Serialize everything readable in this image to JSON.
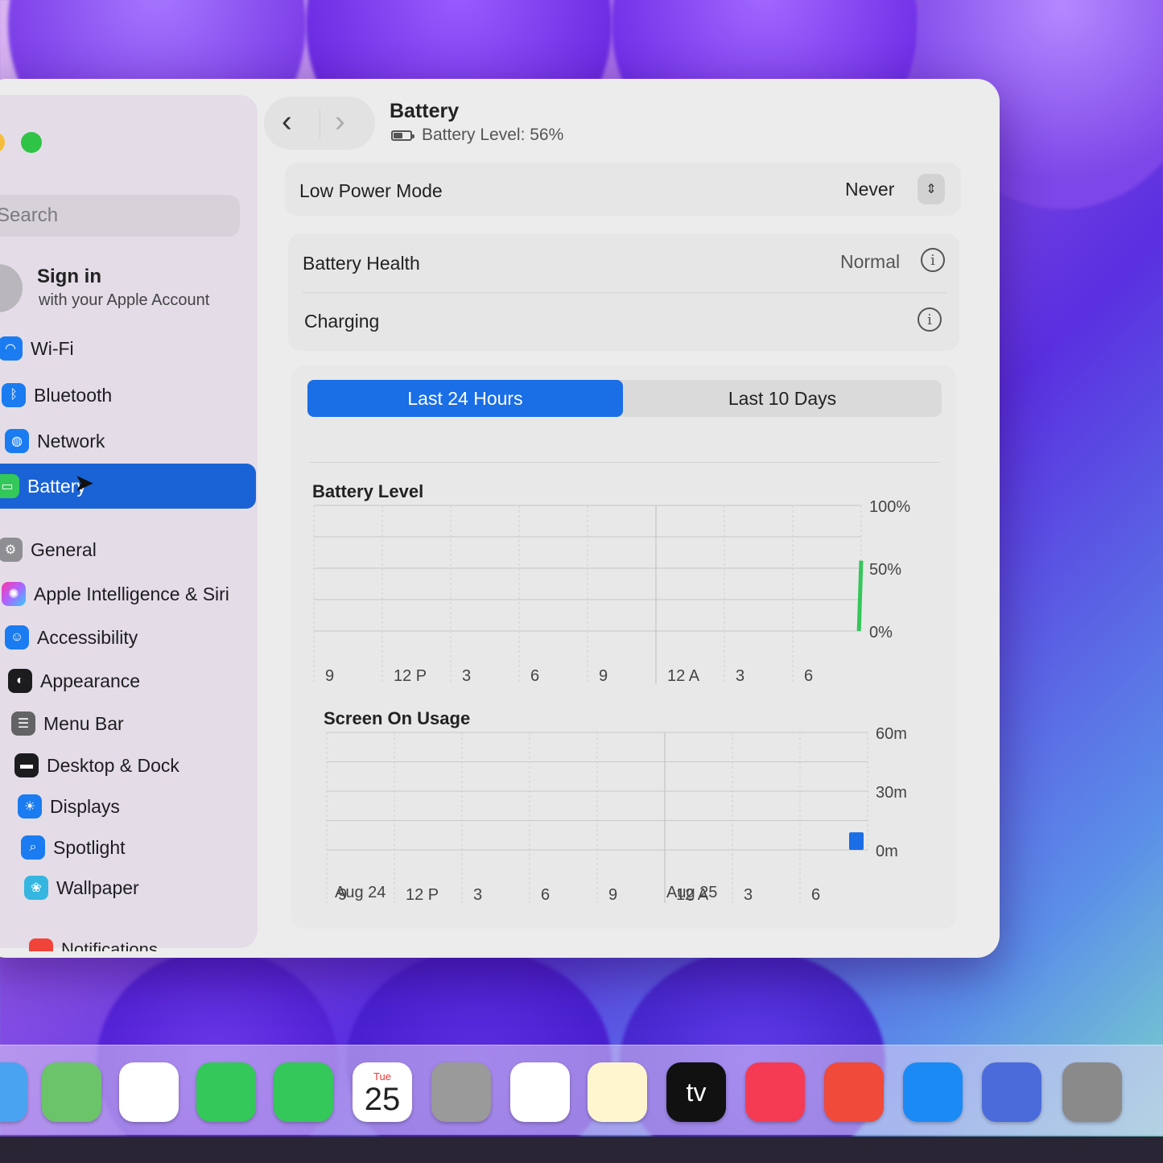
{
  "sidebar": {
    "search_placeholder": "Search",
    "account": {
      "title": "Sign in",
      "subtitle": "with your Apple Account"
    },
    "items": [
      {
        "label": "Wi-Fi",
        "icon": "wifi-icon"
      },
      {
        "label": "Bluetooth",
        "icon": "bluetooth-icon"
      },
      {
        "label": "Network",
        "icon": "globe-icon"
      },
      {
        "label": "Battery",
        "icon": "battery-icon",
        "selected": true
      },
      {
        "label": "General",
        "icon": "gear-icon"
      },
      {
        "label": "Apple Intelligence & Siri",
        "icon": "siri-icon"
      },
      {
        "label": "Accessibility",
        "icon": "accessibility-icon"
      },
      {
        "label": "Appearance",
        "icon": "appearance-icon"
      },
      {
        "label": "Menu Bar",
        "icon": "menubar-icon"
      },
      {
        "label": "Desktop & Dock",
        "icon": "dock-icon"
      },
      {
        "label": "Displays",
        "icon": "sun-icon"
      },
      {
        "label": "Spotlight",
        "icon": "magnifier-icon"
      },
      {
        "label": "Wallpaper",
        "icon": "flower-icon"
      },
      {
        "label": "Notifications",
        "icon": "bell-icon"
      }
    ]
  },
  "header": {
    "title": "Battery",
    "subtitle": "Battery Level: 56%"
  },
  "settings": {
    "low_power_label": "Low Power Mode",
    "low_power_value": "Never",
    "health_label": "Battery Health",
    "health_value": "Normal",
    "charging_label": "Charging"
  },
  "tabs": {
    "active": "Last 24 Hours",
    "inactive": "Last 10 Days"
  },
  "chart_data": [
    {
      "type": "line",
      "title": "Battery Level",
      "x_ticks": [
        "9",
        "12 P",
        "3",
        "6",
        "9",
        "12 A",
        "3",
        "6"
      ],
      "y_ticks": [
        "100%",
        "50%",
        "0%"
      ],
      "ylim": [
        0,
        100
      ],
      "series": [
        {
          "x": [
            23.9,
            24.0
          ],
          "values": [
            0,
            56
          ],
          "color": "#34c759"
        }
      ]
    },
    {
      "type": "bar",
      "title": "Screen On Usage",
      "x_ticks": [
        "9",
        "12 P",
        "3",
        "6",
        "9",
        "12 A",
        "3",
        "6"
      ],
      "dates": [
        "Aug 24",
        "Aug 25"
      ],
      "y_ticks": [
        "60m",
        "30m",
        "0m"
      ],
      "ylim": [
        0,
        60
      ],
      "series": [
        {
          "x": [
            23.5
          ],
          "values": [
            9
          ],
          "color": "#1a6ee6"
        }
      ]
    }
  ],
  "dock": [
    {
      "name": "finder-icon",
      "color": "#4aa3f0"
    },
    {
      "name": "maps-icon",
      "color": "#6cc46a"
    },
    {
      "name": "photos-icon",
      "color": "#ffffff"
    },
    {
      "name": "facetime-icon",
      "color": "#34c759"
    },
    {
      "name": "phone-icon",
      "color": "#34c759"
    },
    {
      "name": "calendar-icon",
      "color": "#ffffff",
      "day": "Tue",
      "date": "25"
    },
    {
      "name": "contacts-icon",
      "color": "#9a9a9a"
    },
    {
      "name": "reminders-icon",
      "color": "#ffffff"
    },
    {
      "name": "notes-icon",
      "color": "#fff6cf"
    },
    {
      "name": "tv-icon",
      "color": "#111111",
      "text": "tv"
    },
    {
      "name": "music-icon",
      "color": "#f43b53"
    },
    {
      "name": "launchpad-icon",
      "color": "#f04a3a"
    },
    {
      "name": "app-store-icon",
      "color": "#1c8af5"
    },
    {
      "name": "iphone-mirroring-icon",
      "color": "#4b6bdb"
    },
    {
      "name": "system-settings-icon",
      "color": "#8a8a8a"
    }
  ]
}
